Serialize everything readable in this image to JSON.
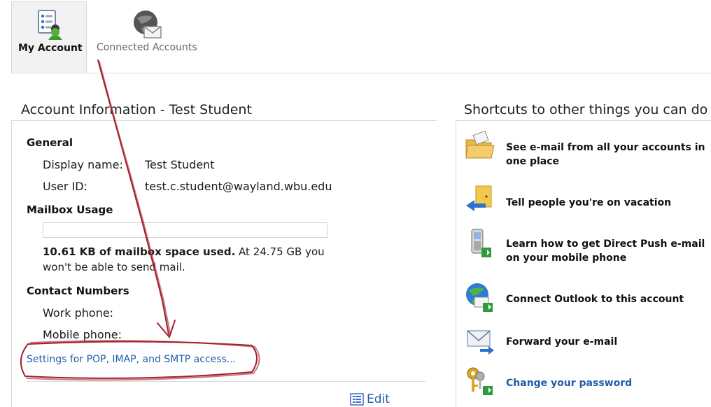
{
  "toolbar": {
    "tabs": [
      {
        "label": "My Account",
        "icon": "my-account-icon",
        "selected": true
      },
      {
        "label": "Connected Accounts",
        "icon": "globe-envelope-icon",
        "selected": false
      }
    ]
  },
  "account": {
    "title": "Account Information - Test Student",
    "general": {
      "heading": "General",
      "display_name_label": "Display name:",
      "display_name": "Test Student",
      "user_id_label": "User ID:",
      "user_id": "test.c.student@wayland.wbu.edu"
    },
    "mailbox": {
      "heading": "Mailbox Usage",
      "used_bold": "10.61 KB of mailbox space used.",
      "used_rest": " At 24.75 GB you won't be able to send mail.",
      "used_fraction": 0.0
    },
    "contact": {
      "heading": "Contact Numbers",
      "work_label": "Work phone:",
      "mobile_label": "Mobile phone:"
    },
    "pop_link": "Settings for POP, IMAP, and SMTP access...",
    "edit_label": "Edit"
  },
  "shortcuts": {
    "title": "Shortcuts to other things you can do",
    "items": [
      {
        "label": "See e-mail from all your accounts in one place",
        "icon": "folder-mail-icon",
        "link": false
      },
      {
        "label": "Tell people you're on vacation",
        "icon": "out-of-office-icon",
        "link": false
      },
      {
        "label": "Learn how to get Direct Push e-mail on your mobile phone",
        "icon": "mobile-phone-icon",
        "link": false
      },
      {
        "label": "Connect Outlook to this account",
        "icon": "globe-connect-icon",
        "link": false
      },
      {
        "label": "Forward your e-mail",
        "icon": "forward-mail-icon",
        "link": false
      },
      {
        "label": "Change your password",
        "icon": "keys-icon",
        "link": true
      }
    ]
  },
  "colors": {
    "link": "#1f5fa8",
    "annotation": "#a4202b"
  }
}
